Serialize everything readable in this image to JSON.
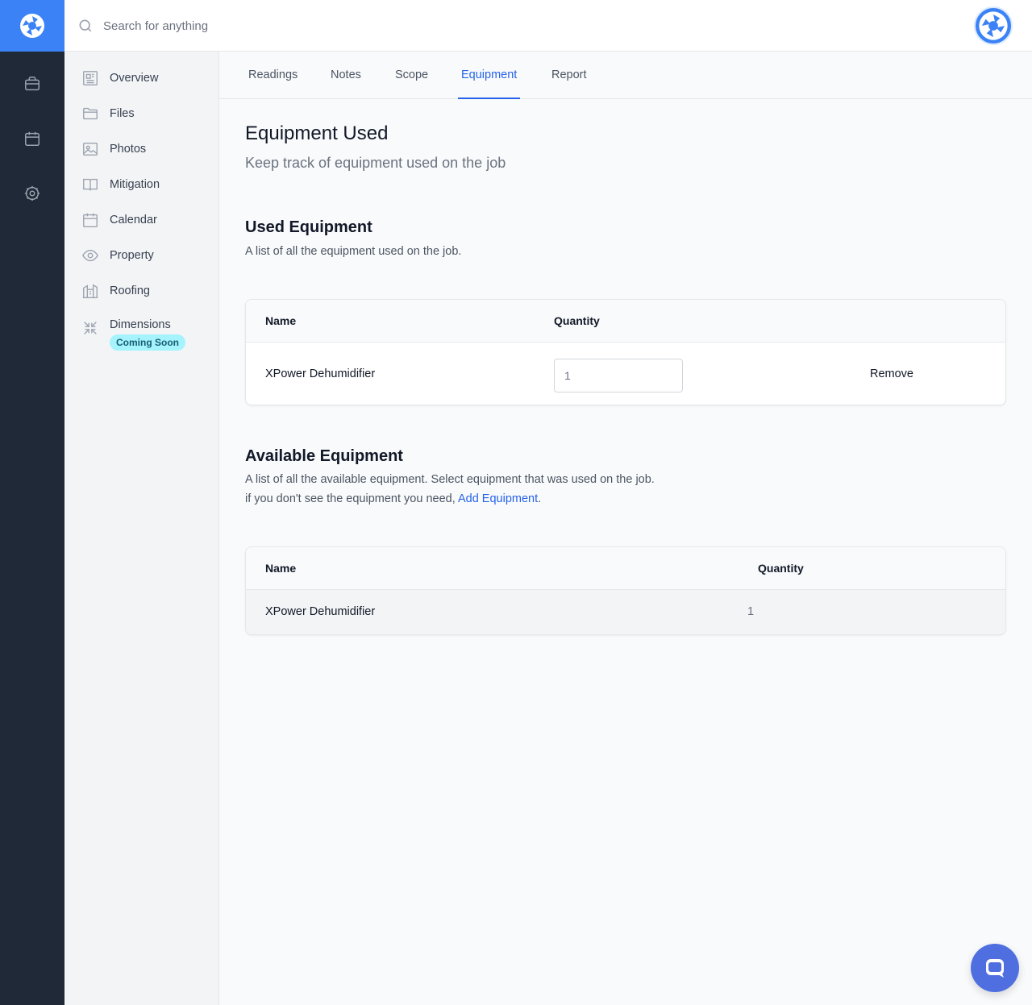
{
  "search": {
    "placeholder": "Search for anything"
  },
  "sidebar": {
    "items": [
      {
        "label": "Overview",
        "icon": "newspaper-icon"
      },
      {
        "label": "Files",
        "icon": "folder-icon"
      },
      {
        "label": "Photos",
        "icon": "image-icon"
      },
      {
        "label": "Mitigation",
        "icon": "book-open-icon"
      },
      {
        "label": "Calendar",
        "icon": "calendar-icon"
      },
      {
        "label": "Property",
        "icon": "eye-icon"
      },
      {
        "label": "Roofing",
        "icon": "building-icon"
      },
      {
        "label": "Dimensions",
        "icon": "arrows-collapse-icon",
        "badge": "Coming Soon"
      }
    ]
  },
  "tabs": [
    {
      "label": "Readings"
    },
    {
      "label": "Notes"
    },
    {
      "label": "Scope"
    },
    {
      "label": "Equipment",
      "active": true
    },
    {
      "label": "Report"
    }
  ],
  "page": {
    "title": "Equipment Used",
    "subtitle": "Keep track of equipment used on the job"
  },
  "used": {
    "title": "Used Equipment",
    "description": "A list of all the equipment used on the job.",
    "columns": {
      "name": "Name",
      "quantity": "Quantity"
    },
    "rows": [
      {
        "name": "XPower Dehumidifier",
        "quantity": "1",
        "action": "Remove"
      }
    ]
  },
  "available": {
    "title": "Available Equipment",
    "description": "A list of all the available equipment. Select equipment that was used on the job.",
    "hint_prefix": "if you don't see the equipment you need,",
    "hint_link": "Add Equipment",
    "hint_suffix": ".",
    "columns": {
      "name": "Name",
      "quantity": "Quantity"
    },
    "rows": [
      {
        "name": "XPower Dehumidifier",
        "quantity": "1"
      }
    ]
  },
  "colors": {
    "accent": "#2563eb",
    "brand": "#3b82f6",
    "rail": "#1f2937",
    "badge_bg": "#a5f3fc"
  }
}
